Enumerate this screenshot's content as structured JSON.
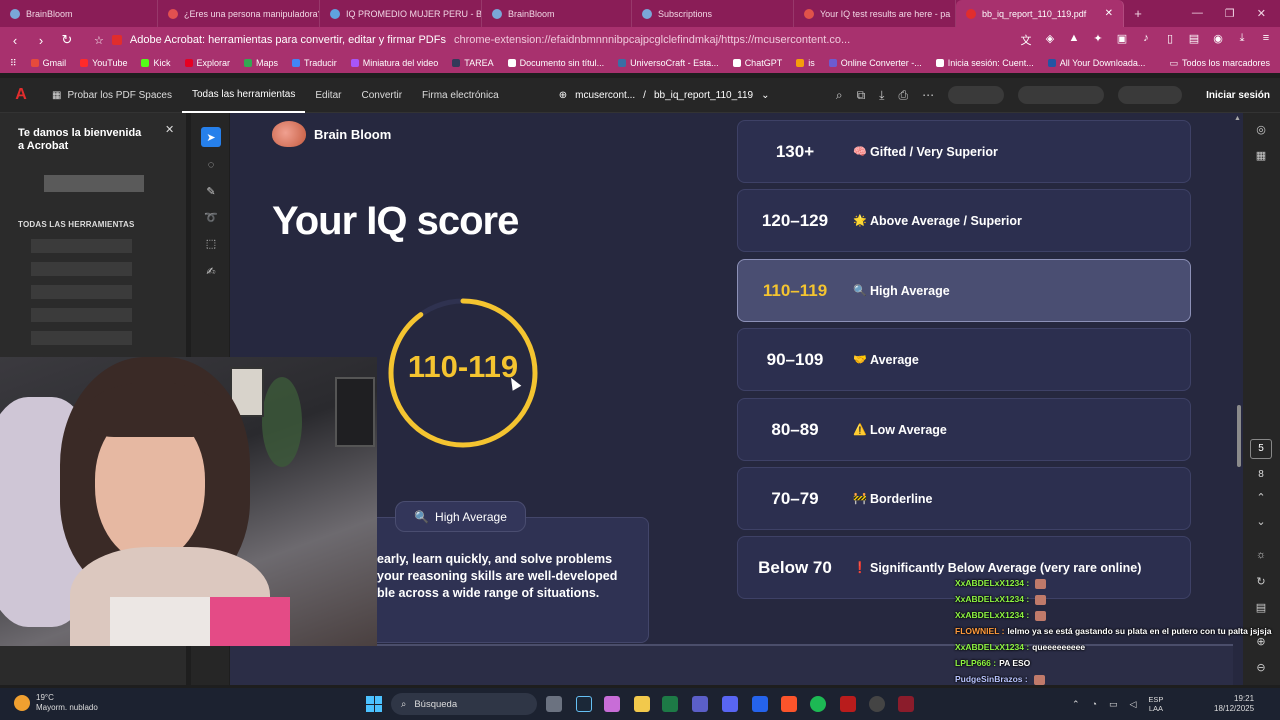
{
  "browser": {
    "tabs": [
      {
        "label": "BrainBloom",
        "color": "#7aa7d8"
      },
      {
        "label": "¿Eres una persona manipuladora?",
        "color": "#e25050"
      },
      {
        "label": "IQ PROMEDIO MUJER PERU - Buscar",
        "color": "#5fa2e0"
      },
      {
        "label": "BrainBloom",
        "color": "#7aa7d8"
      },
      {
        "label": "Subscriptions",
        "color": "#7aa7d8"
      },
      {
        "label": "Your IQ test results are here - pa",
        "color": "#e0524a"
      },
      {
        "label": "bb_iq_report_110_119.pdf",
        "color": "#e12d2d"
      }
    ],
    "active_tab_index": 6,
    "site_title": "Adobe Acrobat: herramientas para convertir, editar y firmar PDFs",
    "url": "chrome-extension://efaidnbmnnnibpcajpcglclefindmkaj/https://mcusercontent.co...",
    "bookmarks": [
      {
        "label": "Gmail",
        "color": "#e64a3b"
      },
      {
        "label": "YouTube",
        "color": "#ff2a2a"
      },
      {
        "label": "Kick",
        "color": "#53fc18"
      },
      {
        "label": "Explorar",
        "color": "#e60023"
      },
      {
        "label": "Maps",
        "color": "#34a853"
      },
      {
        "label": "Traducir",
        "color": "#4285f4"
      },
      {
        "label": "Miniatura del video",
        "color": "#a855f7"
      },
      {
        "label": "TAREA",
        "color": "#333a5a"
      },
      {
        "label": "Documento sin títul...",
        "color": "#ffffff"
      },
      {
        "label": "UniversoCraft - Esta...",
        "color": "#3a6ea5"
      },
      {
        "label": "ChatGPT",
        "color": "#ffffff"
      },
      {
        "label": "is",
        "color": "#f59e0b"
      },
      {
        "label": "Online Converter -...",
        "color": "#6d5bd0"
      },
      {
        "label": "Inicia sesión: Cuent...",
        "color": "#ffffff"
      },
      {
        "label": "All Your Downloada...",
        "color": "#2455a4"
      }
    ],
    "bookmarks_right": "Todos los marcadores"
  },
  "acrobat": {
    "try_spaces": "Probar los PDF Spaces",
    "menu": [
      "Todas las herramientas",
      "Editar",
      "Convertir",
      "Firma electrónica"
    ],
    "file_host": "mcusercont...",
    "file_name": "bb_iq_report_110_119",
    "sign_in": "Iniciar sesión",
    "panel_welcome": "Te damos la bienvenida a Acrobat",
    "panel_section": "TODAS LAS HERRAMIENTAS",
    "current_page": "5",
    "total_pages": "8"
  },
  "report": {
    "brand": "Brain Bloom",
    "title": "Your IQ score",
    "score_range": "110-119",
    "score_fraction": 0.9,
    "badge_icon": "🔍",
    "badge": "High Average",
    "description_lines": [
      "early, learn quickly, and solve problems",
      "your reasoning skills are well-developed",
      "ble across a wide range of situations."
    ],
    "tiers": [
      {
        "range": "130+",
        "icon": "🧠",
        "label": "Gifted / Very Superior"
      },
      {
        "range": "120–129",
        "icon": "🌟",
        "label": "Above Average / Superior"
      },
      {
        "range": "110–119",
        "icon": "🔍",
        "label": "High Average",
        "highlight": true
      },
      {
        "range": "90–109",
        "icon": "🤝",
        "label": "Average"
      },
      {
        "range": "80–89",
        "icon": "⚠️",
        "label": "Low Average"
      },
      {
        "range": "70–79",
        "icon": "🚧",
        "label": "Borderline"
      },
      {
        "range": "Below 70",
        "icon": "❗",
        "label": "Significantly Below Average (very rare online)"
      }
    ]
  },
  "chat": [
    {
      "user": "XxABDELxX1234 :",
      "color": "#8ef542",
      "msg": ""
    },
    {
      "user": "XxABDELxX1234 :",
      "color": "#8ef542",
      "msg": ""
    },
    {
      "user": "XxABDELxX1234 :",
      "color": "#8ef542",
      "msg": ""
    },
    {
      "user": "FLOWNIEL :",
      "color": "#ff9a3c",
      "msg": "lelmo ya se está gastando su plata en el putero con tu palta jsjsja"
    },
    {
      "user": "XxABDELxX1234 :",
      "color": "#8ef542",
      "msg": "queeeeeeeee"
    },
    {
      "user": "LPLP666 :",
      "color": "#8ef542",
      "msg": "PA ESO"
    },
    {
      "user": "PudgeSinBrazos :",
      "color": "#b9c4ff",
      "msg": ""
    },
    {
      "user": "PudgeSinBrazos :",
      "color": "#b9c4ff",
      "msg": ""
    }
  ],
  "taskbar": {
    "temp": "19°C",
    "weather": "Mayorm. nublado",
    "search": "Búsqueda",
    "lang": "ESP",
    "layout": "LAA",
    "time": "19:21",
    "date": "18/12/2025"
  }
}
